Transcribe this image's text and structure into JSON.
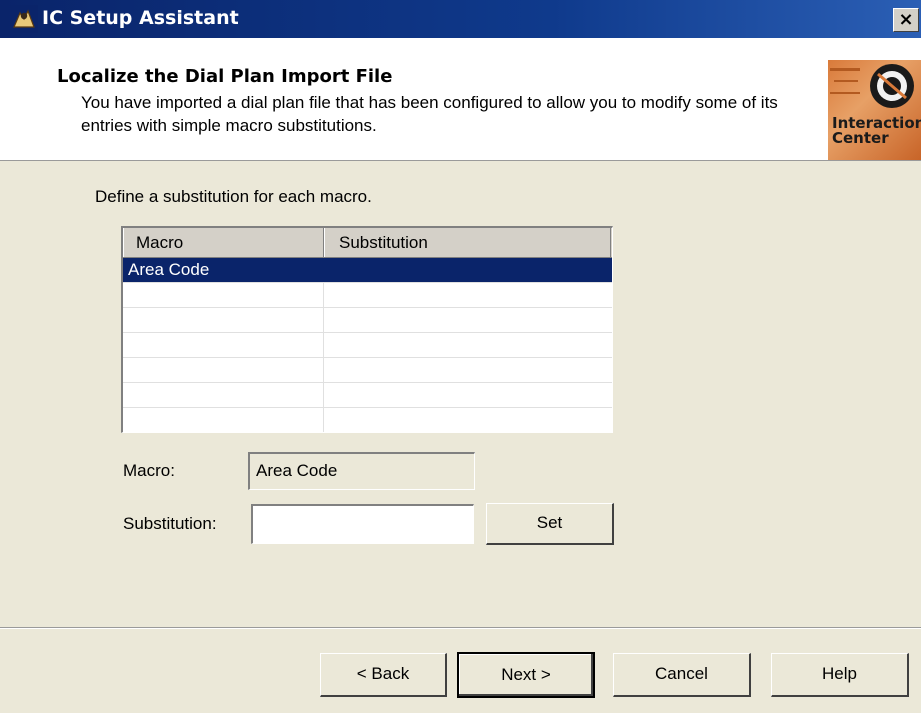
{
  "window": {
    "title": "IC Setup Assistant",
    "close_label": "×"
  },
  "header": {
    "title": "Localize the Dial Plan Import File",
    "description": "You have imported a dial plan file that has been configured to allow you to modify some of its entries with simple macro substitutions.",
    "logo_line1": "Interaction",
    "logo_line2": "Center"
  },
  "main": {
    "instruction": "Define a substitution for each macro.",
    "list": {
      "columns": [
        "Macro",
        "Substitution"
      ],
      "rows": [
        {
          "macro": "Area Code",
          "substitution": "",
          "selected": true
        },
        {
          "macro": "",
          "substitution": ""
        },
        {
          "macro": "",
          "substitution": ""
        },
        {
          "macro": "",
          "substitution": ""
        },
        {
          "macro": "",
          "substitution": ""
        },
        {
          "macro": "",
          "substitution": ""
        },
        {
          "macro": "",
          "substitution": ""
        }
      ]
    },
    "macro_label": "Macro:",
    "macro_value": "Area Code",
    "substitution_label": "Substitution:",
    "substitution_value": "",
    "set_label": "Set"
  },
  "footer": {
    "back_label": "< Back",
    "next_label": "Next >",
    "cancel_label": "Cancel",
    "help_label": "Help"
  },
  "colors": {
    "titlebar": "#0a246a",
    "selection": "#0a246a",
    "dialog_bg": "#ebe8d8"
  }
}
